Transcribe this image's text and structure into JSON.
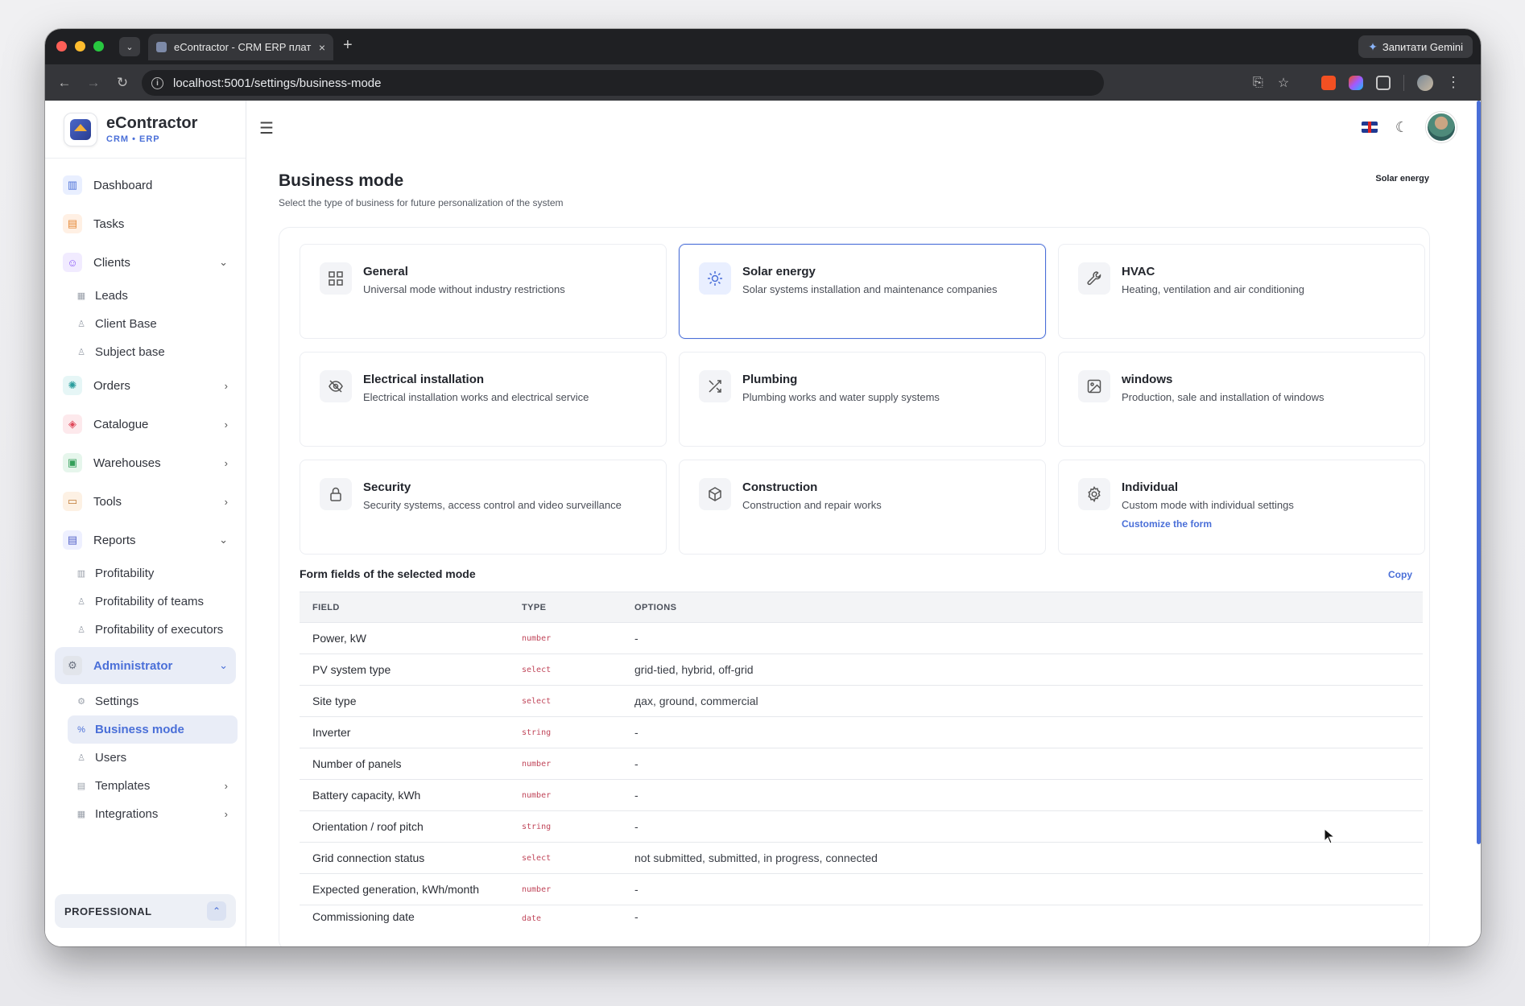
{
  "browser": {
    "tab_title": "eContractor - CRM ERP плат",
    "url": "localhost:5001/settings/business-mode",
    "gemini_label": "Запитати Gemini"
  },
  "brand": {
    "name": "eContractor",
    "sub": "CRM • ERP"
  },
  "sidebar": {
    "items": [
      {
        "label": "Dashboard"
      },
      {
        "label": "Tasks"
      },
      {
        "label": "Clients",
        "children": [
          {
            "label": "Leads"
          },
          {
            "label": "Client Base"
          },
          {
            "label": "Subject base"
          }
        ]
      },
      {
        "label": "Orders"
      },
      {
        "label": "Catalogue"
      },
      {
        "label": "Warehouses"
      },
      {
        "label": "Tools"
      },
      {
        "label": "Reports",
        "children": [
          {
            "label": "Profitability"
          },
          {
            "label": "Profitability of teams"
          },
          {
            "label": "Profitability of executors"
          }
        ]
      },
      {
        "label": "Administrator",
        "children": [
          {
            "label": "Settings"
          },
          {
            "label": "Business mode"
          },
          {
            "label": "Users"
          },
          {
            "label": "Templates"
          },
          {
            "label": "Integrations"
          }
        ]
      }
    ],
    "plan": "PROFESSIONAL"
  },
  "header": {
    "title": "Business mode",
    "subtitle": "Select the type of business for future personalization of the system",
    "current_mode": "Solar energy"
  },
  "modes": [
    {
      "title": "General",
      "desc": "Universal mode without industry restrictions",
      "icon": "grid-icon"
    },
    {
      "title": "Solar energy",
      "desc": "Solar systems installation and maintenance companies",
      "icon": "sun-icon",
      "selected": true
    },
    {
      "title": "HVAC",
      "desc": "Heating, ventilation and air conditioning",
      "icon": "wrench-icon"
    },
    {
      "title": "Electrical installation",
      "desc": "Electrical installation works and electrical service",
      "icon": "eye-off-icon"
    },
    {
      "title": "Plumbing",
      "desc": "Plumbing works and water supply systems",
      "icon": "shuffle-icon"
    },
    {
      "title": "windows",
      "desc": "Production, sale and installation of windows",
      "icon": "image-icon"
    },
    {
      "title": "Security",
      "desc": "Security systems, access control and video surveillance",
      "icon": "lock-icon"
    },
    {
      "title": "Construction",
      "desc": "Construction and repair works",
      "icon": "box-icon"
    },
    {
      "title": "Individual",
      "desc": "Custom mode with individual settings",
      "icon": "gear-icon",
      "link": "Customize the form"
    }
  ],
  "fields_section": {
    "title": "Form fields of the selected mode",
    "copy_label": "Copy",
    "columns": [
      "FIELD",
      "TYPE",
      "OPTIONS"
    ],
    "rows": [
      {
        "field": "Power, kW",
        "type": "number",
        "options": "-"
      },
      {
        "field": "PV system type",
        "type": "select",
        "options": "grid-tied, hybrid, off-grid"
      },
      {
        "field": "Site type",
        "type": "select",
        "options": "дах, ground, commercial"
      },
      {
        "field": "Inverter",
        "type": "string",
        "options": "-"
      },
      {
        "field": "Number of panels",
        "type": "number",
        "options": "-"
      },
      {
        "field": "Battery capacity, kWh",
        "type": "number",
        "options": "-"
      },
      {
        "field": "Orientation / roof pitch",
        "type": "string",
        "options": "-"
      },
      {
        "field": "Grid connection status",
        "type": "select",
        "options": "not submitted, submitted, in progress, connected"
      },
      {
        "field": "Expected generation, kWh/month",
        "type": "number",
        "options": "-"
      },
      {
        "field": "Commissioning date",
        "type": "date",
        "options": "-"
      }
    ]
  }
}
